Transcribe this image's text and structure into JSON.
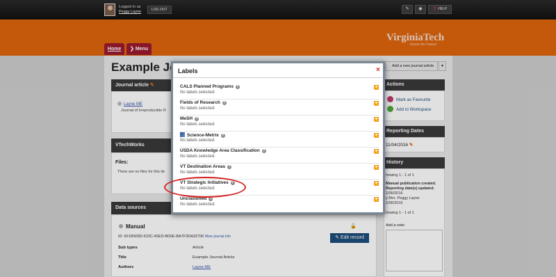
{
  "topbar": {
    "logged_in_prefix": "Logged in as",
    "user_name": "Peggy Layne",
    "logout_label": "LOG OUT",
    "help_label": "HELP"
  },
  "brand": {
    "logo": "VirginiaTech",
    "tagline": "Invent the Future",
    "accent_color": "#e0660e",
    "maroon_color": "#9b1a2e"
  },
  "breadcrumb": {
    "home": "Home",
    "menu": "Menu"
  },
  "page": {
    "title": "Example Jou"
  },
  "journal_panel": {
    "title": "Journal article",
    "author": "Layne ME",
    "journal": "Journal of Irreproducible R"
  },
  "vtechworks": {
    "title": "VTechWorks",
    "files_label": "Files:",
    "files_none": "There are no files for this ite"
  },
  "data_sources": {
    "title": "Data sources",
    "manual": "Manual",
    "id": "ID: 6F1B509D-523C-45ED-BD0E-BA7F3DA32706",
    "more_info": "More journal info",
    "edit_label": "Edit record",
    "rows": [
      {
        "label": "Sub types",
        "value": "Article"
      },
      {
        "label": "Title",
        "value": "Example Journal Article"
      },
      {
        "label": "Authors",
        "value": "Layne ME"
      }
    ]
  },
  "sidebar": {
    "add_journal": "Add a new journal article",
    "actions_title": "Actions",
    "mark_favourite": "Mark as Favourite",
    "add_workspace": "Add to Workspace",
    "reporting_title": "Reporting Dates",
    "reporting_date": "11/04/2016",
    "history_title": "History",
    "history_showing": "howing 1 - 1 of 1",
    "history_event1": "Manual publication created.",
    "history_event2": "Reporting date(s) updated.",
    "history_date": "1/06/2016",
    "history_by": "y Mrs. Peggy Layne",
    "history_date2": "1/06/2016",
    "history_showing2": "howing 1 - 1 of 1",
    "note_label": "Add a note:"
  },
  "modal": {
    "title": "Labels",
    "close": "×",
    "no_labels": "No labels selected.",
    "categories": [
      "CALS Planned Programs",
      "Fields of Research",
      "MeSH",
      "Science-Metrix",
      "USDA Knowledge Area Classification",
      "VT Destination Areas",
      "VT Strategic Initiatives",
      "Unclassified"
    ]
  }
}
